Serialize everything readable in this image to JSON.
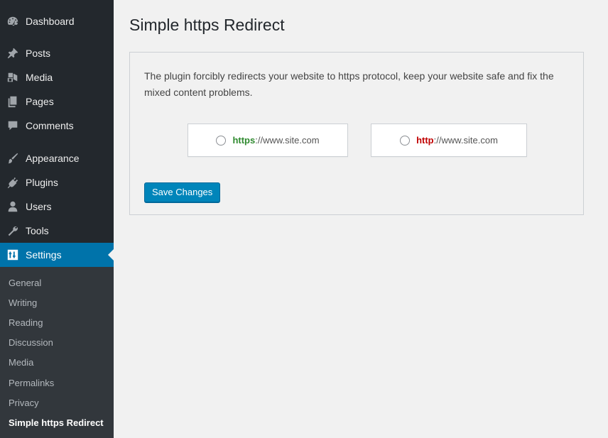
{
  "sidebar": {
    "items": [
      {
        "label": "Dashboard",
        "icon": "dashboard-icon"
      },
      {
        "label": "Posts",
        "icon": "pin-icon"
      },
      {
        "label": "Media",
        "icon": "media-icon"
      },
      {
        "label": "Pages",
        "icon": "pages-icon"
      },
      {
        "label": "Comments",
        "icon": "comment-icon"
      },
      {
        "label": "Appearance",
        "icon": "brush-icon"
      },
      {
        "label": "Plugins",
        "icon": "plugin-icon"
      },
      {
        "label": "Users",
        "icon": "user-icon"
      },
      {
        "label": "Tools",
        "icon": "wrench-icon"
      },
      {
        "label": "Settings",
        "icon": "settings-icon",
        "current": true
      }
    ],
    "submenu": [
      {
        "label": "General"
      },
      {
        "label": "Writing"
      },
      {
        "label": "Reading"
      },
      {
        "label": "Discussion"
      },
      {
        "label": "Media"
      },
      {
        "label": "Permalinks"
      },
      {
        "label": "Privacy"
      },
      {
        "label": "Simple https Redirect",
        "current": true
      }
    ]
  },
  "page": {
    "title": "Simple https Redirect",
    "description": "The plugin forcibly redirects your website to https protocol, keep your website safe and fix the mixed content problems.",
    "options": [
      {
        "protocol": "https",
        "rest": "://www.site.com",
        "color": "#2f8a2f",
        "selected": false
      },
      {
        "protocol": "http",
        "rest": "://www.site.com",
        "color": "#c00000",
        "selected": false
      }
    ],
    "save_label": "Save Changes"
  },
  "colors": {
    "sidebar_bg": "#23282d",
    "submenu_bg": "#32373c",
    "accent": "#0073aa",
    "button": "#0085ba"
  }
}
